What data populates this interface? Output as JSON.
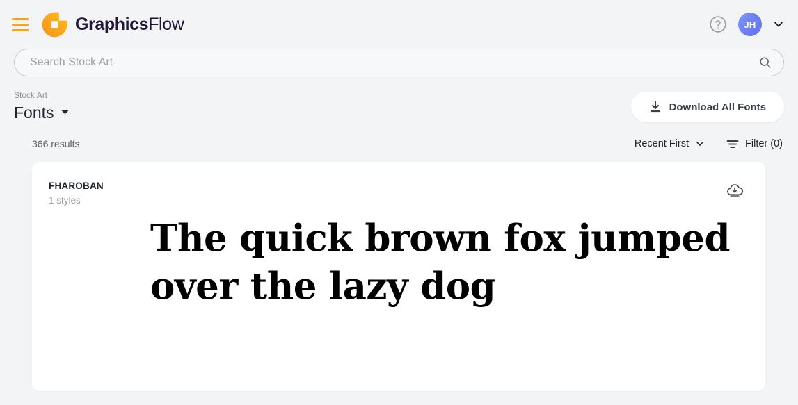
{
  "header": {
    "menu_icon": "hamburger-icon",
    "logo_icon": "graphicsflow-logo-icon",
    "brand_bold": "Graphics",
    "brand_light": "Flow",
    "help_icon": "help-circle-icon",
    "avatar_initials": "JH",
    "account_caret_icon": "chevron-down-icon",
    "brand_accent": "#f9a21b",
    "wordmark_color": "#231735",
    "avatar_color": "#6170ef"
  },
  "search": {
    "value": "",
    "placeholder": "Search Stock Art",
    "icon": "search-icon"
  },
  "titlebar": {
    "breadcrumb": "Stock Art",
    "title": "Fonts",
    "title_caret_icon": "caret-down-icon",
    "download_all_label": "Download All Fonts",
    "download_all_icon": "download-icon"
  },
  "results": {
    "count_label": "366 results",
    "sort_label": "Recent First",
    "sort_caret_icon": "chevron-down-icon",
    "filter_label": "Filter (0)",
    "filter_icon": "filter-icon"
  },
  "cards": [
    {
      "name": "FHAROBAN",
      "styles": "1 styles",
      "download_icon": "cloud-download-icon",
      "specimen": "The quick brown fox jumped over the lazy dog"
    }
  ]
}
